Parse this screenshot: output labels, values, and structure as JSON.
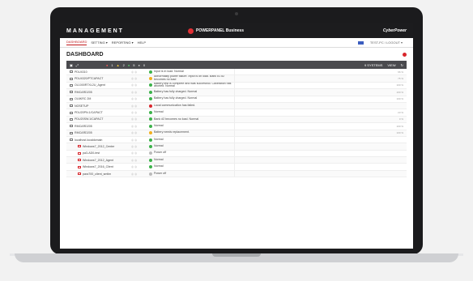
{
  "topbar": {
    "app": "MANAGEMENT",
    "brand": "POWERPANEL Business",
    "vendor": "CyberPower"
  },
  "menu": {
    "items": [
      "DASHBOARD",
      "SETTING ▾",
      "REPORTING ▾",
      "HELP"
    ],
    "user": "TEST-PC / LOGOUT ▾"
  },
  "page": {
    "title": "DASHBOARD"
  },
  "toolbar": {
    "critical": "1",
    "warning": "2",
    "normal": "5",
    "offline": "0",
    "systems": "9 SYSTEMS",
    "view": "VIEW"
  },
  "rows": [
    {
      "name": "PDU4310",
      "status": "ok",
      "msg": "Input is in load. Normal",
      "extra": "96 %"
    },
    {
      "name": "PDU4320/PTCAPACT",
      "status": "warn",
      "msg": "Abnormality power failure. Input is on load. Bank #1 #2 becomes no load",
      "extra": "75 %"
    },
    {
      "name": "OL1000RTXL2U_Agent",
      "status": "ok",
      "msg": "Battery test is complete and was successful. Calibration has aborted. Normal",
      "extra": "100 %"
    },
    {
      "name": "RMCARD205",
      "status": "ok",
      "msg": "Battery has fully charged. Normal",
      "extra": "100 %"
    },
    {
      "name": "OL6KRC 2M",
      "status": "ok",
      "msg": "Battery has fully charged. Normal",
      "extra": "100 %"
    },
    {
      "name": "NOSETUP",
      "status": "crit",
      "msg": "Local communication has failed.",
      "extra": ""
    },
    {
      "name": "PDU20PN.1/CAPACT",
      "status": "ok",
      "msg": "Normal",
      "extra": "23 %"
    },
    {
      "name": "PDU20SW.1/CAPACT",
      "status": "ok",
      "msg": "Bank #2 becomes no load. Normal",
      "extra": "0 %"
    },
    {
      "name": "RMCARD205",
      "status": "ok",
      "msg": "Normal",
      "extra": "100 %"
    },
    {
      "name": "RMCARD205",
      "status": "warn",
      "msg": "Battery needs replacement.",
      "extra": "100 %"
    },
    {
      "name": "localhost.localdomain",
      "status": "ok",
      "msg": "Normal",
      "extra": ""
    },
    {
      "name": "Windows7_2012_Center",
      "status": "ok",
      "msg": "Normal",
      "extra": "",
      "vm": true
    },
    {
      "name": "pa3-AD0-test",
      "status": "off",
      "msg": "Power off",
      "extra": "",
      "vm": true
    },
    {
      "name": "Windows7_2012_Agent",
      "status": "ok",
      "msg": "Normal",
      "extra": "",
      "vm": true
    },
    {
      "name": "Windows7_2016_Client",
      "status": "ok",
      "msg": "Normal",
      "extra": "",
      "vm": true
    },
    {
      "name": "para700_client_smtlm",
      "status": "off",
      "msg": "Power off",
      "extra": "",
      "vm": true
    }
  ]
}
